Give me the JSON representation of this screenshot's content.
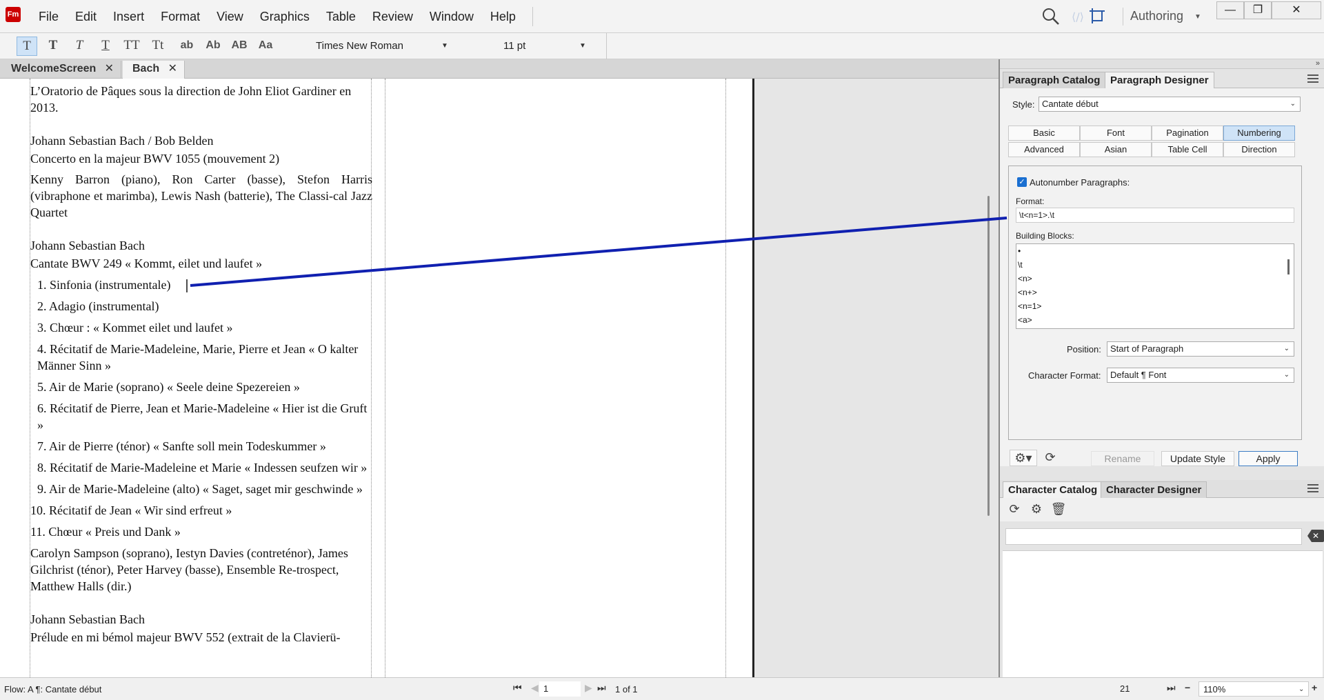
{
  "app": {
    "logo": "Fm"
  },
  "menu": [
    "File",
    "Edit",
    "Insert",
    "Format",
    "View",
    "Graphics",
    "Table",
    "Review",
    "Window",
    "Help"
  ],
  "toolbar_right": {
    "workspace": "Authoring"
  },
  "window_buttons": {
    "minimize": "—",
    "restore": "❐",
    "close": "✕"
  },
  "format_toolbar": {
    "buttons": [
      "T",
      "T",
      "T",
      "T",
      "TT",
      "Tt",
      "ab",
      "Ab",
      "AB",
      "Aa"
    ],
    "font": "Times New Roman",
    "size": "11 pt"
  },
  "doc_tabs": [
    {
      "label": "WelcomeScreen"
    },
    {
      "label": "Bach"
    }
  ],
  "document": {
    "paragraphs": [
      "L’Oratorio de Pâques sous la direction de John Eliot Gardiner en 2013.",
      "Johann Sebastian Bach / Bob Belden",
      "Concerto en la majeur BWV 1055 (mouvement 2)",
      "Kenny Barron (piano), Ron Carter (basse), Stefon Harris (vibraphone et marimba), Lewis Nash (batterie), The Classi-cal Jazz Quartet",
      "Johann Sebastian Bach",
      "Cantate BWV 249 « Kommt, eilet und laufet »",
      "1. Sinfonia (instrumentale)",
      "2. Adagio (instrumental)",
      "3. Chœur : « Kommet eilet und laufet »",
      "4. Récitatif de Marie-Madeleine, Marie, Pierre et Jean « O kalter Männer Sinn »",
      "5. Air de Marie (soprano) « Seele deine Spezereien »",
      "6. Récitatif de Pierre, Jean et Marie-Madeleine « Hier ist die Gruft »",
      "7. Air de Pierre (ténor) « Sanfte soll mein Todeskummer »",
      "8. Récitatif de Marie-Madeleine et Marie « Indessen seufzen wir »",
      "9. Air de Marie-Madeleine (alto) « Saget, saget mir geschwinde »",
      "10. Récitatif de Jean « Wir sind erfreut »",
      "11. Chœur « Preis und Dank »",
      "Carolyn Sampson (soprano), Iestyn Davies (contreténor), James Gilchrist (ténor), Peter Harvey (basse), Ensemble Re-trospect, Matthew Halls (dir.)",
      "Johann Sebastian Bach",
      "Prélude en mi bémol majeur BWV 552 (extrait de la Clavierü-"
    ]
  },
  "paragraph_panel": {
    "tabs": [
      "Paragraph Catalog",
      "Paragraph Designer"
    ],
    "style_label": "Style:",
    "style_value": "Cantate début",
    "categories": [
      "Basic",
      "Font",
      "Pagination",
      "Numbering",
      "Advanced",
      "Asian",
      "Table Cell",
      "Direction"
    ],
    "autonumber_label": "Autonumber Paragraphs:",
    "format_label": "Format:",
    "format_value": "\\t<n=1>.\\t",
    "building_blocks_label": "Building Blocks:",
    "building_blocks": [
      "•",
      "\\t",
      "<n>",
      "<n+>",
      "<n=1>",
      "<a>"
    ],
    "position_label": "Position:",
    "position_value": "Start of Paragraph",
    "char_format_label": "Character Format:",
    "char_format_value": "Default ¶ Font",
    "rename": "Rename",
    "update_style": "Update Style",
    "apply": "Apply"
  },
  "character_panel": {
    "tabs": [
      "Character Catalog",
      "Character Designer"
    ]
  },
  "status": {
    "flow": "Flow: A  ¶: Cantate début",
    "page": "1",
    "page_of": "1 of 1",
    "value": "21",
    "zoom": "110%"
  },
  "colors": {
    "accent": "#1a6fd1",
    "connector": "#1020b0",
    "active_tab": "#cfe3f7"
  }
}
